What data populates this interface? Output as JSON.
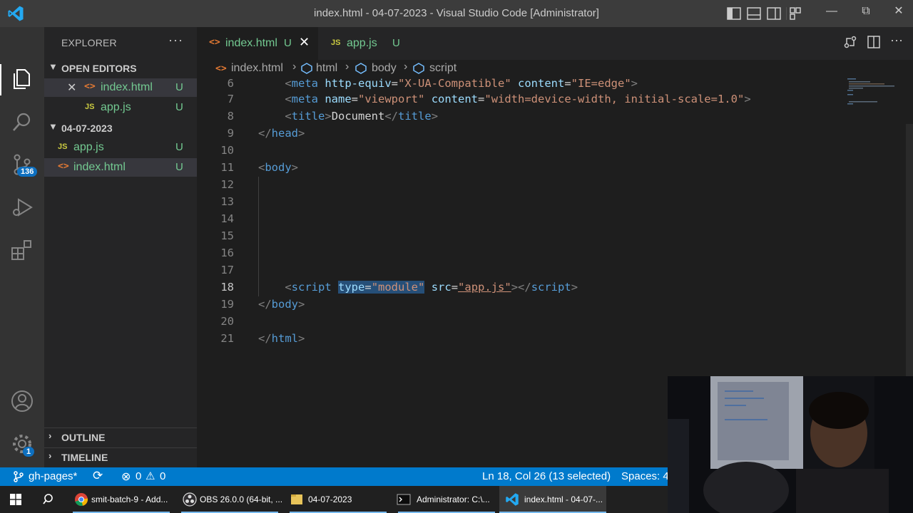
{
  "window": {
    "title": "index.html - 04-07-2023 - Visual Studio Code [Administrator]",
    "controls": {
      "minimize": "—",
      "restore": "⧉",
      "close": "✕"
    }
  },
  "activity_bar": {
    "items": [
      "files-icon",
      "search-icon",
      "source-control-icon",
      "run-debug-icon",
      "extensions-icon",
      "account-icon",
      "settings-icon"
    ],
    "source_control_badge": "136",
    "settings_badge": "1"
  },
  "sidebar": {
    "title": "EXPLORER",
    "more": "···",
    "open_editors": {
      "label": "OPEN EDITORS",
      "items": [
        {
          "icon": "<>",
          "name": "index.html",
          "status": "U"
        },
        {
          "icon": "JS",
          "name": "app.js",
          "status": "U"
        }
      ]
    },
    "folder": {
      "label": "04-07-2023",
      "items": [
        {
          "icon": "JS",
          "name": "app.js",
          "status": "U"
        },
        {
          "icon": "<>",
          "name": "index.html",
          "status": "U"
        }
      ]
    },
    "outline_label": "OUTLINE",
    "timeline_label": "TIMELINE"
  },
  "tabs": [
    {
      "icon": "<>",
      "name": "index.html",
      "status": "U",
      "active": true
    },
    {
      "icon": "JS",
      "name": "app.js",
      "status": "U",
      "active": false
    }
  ],
  "editor_actions": [
    "compare-changes-icon",
    "split-editor-icon",
    "more-actions-icon"
  ],
  "breadcrumb": {
    "icon": "<>",
    "items": [
      "index.html",
      "html",
      "body",
      "script"
    ]
  },
  "editor": {
    "line_numbers": [
      "6",
      "7",
      "8",
      "9",
      "10",
      "11",
      "12",
      "13",
      "14",
      "15",
      "16",
      "17",
      "18",
      "19",
      "20",
      "21"
    ],
    "current_line": "18",
    "lines": {
      "l6": {
        "p1": "<",
        "tag": "meta",
        "a1": "http-equiv",
        "eq1": "=",
        "v1": "\"X-UA-Compatible\"",
        "a2": "content",
        "eq2": "=",
        "v2": "\"IE=edge\"",
        "p2": ">"
      },
      "l7": {
        "p1": "<",
        "tag": "meta",
        "a1": "name",
        "eq1": "=",
        "v1": "\"viewport\"",
        "a2": "content",
        "eq2": "=",
        "v2": "\"width=device-width, initial-scale=1.0\"",
        "p2": ">"
      },
      "l8": {
        "p1": "<",
        "tag": "title",
        "p2": ">",
        "text": "Document",
        "p3": "</",
        "tag2": "title",
        "p4": ">"
      },
      "l9": {
        "p1": "</",
        "tag": "head",
        "p2": ">"
      },
      "l11": {
        "p1": "<",
        "tag": "body",
        "p2": ">"
      },
      "l18": {
        "p1": "<",
        "tag": "script",
        "a1": "type",
        "eq1": "=",
        "v1": "\"module\"",
        "a2": "src",
        "eq2": "=",
        "v2": "\"app.js\"",
        "p2": "></",
        "tag2": "script",
        "p3": ">"
      },
      "l19": {
        "p1": "</",
        "tag": "body",
        "p2": ">"
      },
      "l21": {
        "p1": "</",
        "tag": "html",
        "p2": ">"
      }
    }
  },
  "status_bar": {
    "branch": "gh-pages*",
    "errors": "0",
    "warnings": "0",
    "cursor": "Ln 18, Col 26 (13 selected)",
    "spaces": "Spaces: 4",
    "accent": "#007acc"
  },
  "taskbar": {
    "items": [
      {
        "label": "smit-batch-9 - Add...",
        "icon": "chrome-icon"
      },
      {
        "label": "OBS 26.0.0 (64-bit, ...",
        "icon": "obs-icon"
      },
      {
        "label": "04-07-2023",
        "icon": "folder-icon"
      },
      {
        "label": "Administrator: C:\\...",
        "icon": "terminal-icon"
      },
      {
        "label": "index.html - 04-07-...",
        "icon": "vscode-icon"
      }
    ]
  }
}
